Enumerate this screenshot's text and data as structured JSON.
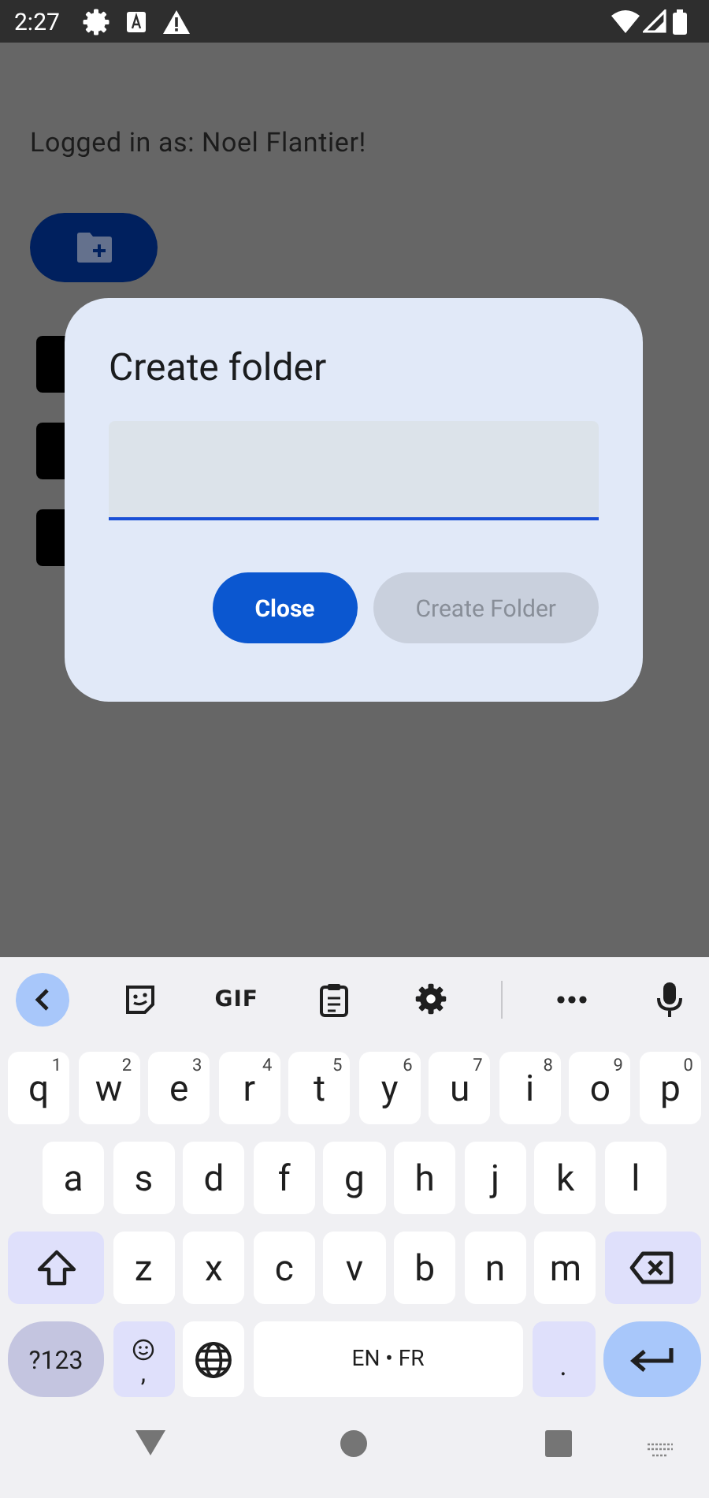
{
  "status_bar": {
    "time": "2:27"
  },
  "app": {
    "greeting": "Logged in as: Noel Flantier!"
  },
  "dialog": {
    "title": "Create folder",
    "field": {
      "focused": true
    },
    "buttons": [
      {
        "label": "Close",
        "disabled": false
      },
      {
        "label": "Create Folder",
        "disabled": true
      }
    ]
  },
  "keyboard": {
    "toolbar": [
      {
        "kind": "back"
      },
      {
        "kind": "sticker"
      },
      {
        "kind": "gif",
        "label": "GIF"
      },
      {
        "kind": "clipboard"
      },
      {
        "kind": "settings"
      },
      {
        "kind": "more"
      },
      {
        "kind": "mic"
      }
    ],
    "rows": [
      {
        "keys": [
          {
            "kind": "letter",
            "label": "q",
            "hint": "1"
          },
          {
            "kind": "letter",
            "label": "w",
            "hint": "2"
          },
          {
            "kind": "letter",
            "label": "e",
            "hint": "3"
          },
          {
            "kind": "letter",
            "label": "r",
            "hint": "4"
          },
          {
            "kind": "letter",
            "label": "t",
            "hint": "5"
          },
          {
            "kind": "letter",
            "label": "y",
            "hint": "6"
          },
          {
            "kind": "letter",
            "label": "u",
            "hint": "7"
          },
          {
            "kind": "letter",
            "label": "i",
            "hint": "8"
          },
          {
            "kind": "letter",
            "label": "o",
            "hint": "9"
          },
          {
            "kind": "letter",
            "label": "p",
            "hint": "0"
          }
        ]
      },
      {
        "keys": [
          {
            "kind": "letter",
            "label": "a"
          },
          {
            "kind": "letter",
            "label": "s"
          },
          {
            "kind": "letter",
            "label": "d"
          },
          {
            "kind": "letter",
            "label": "f"
          },
          {
            "kind": "letter",
            "label": "g"
          },
          {
            "kind": "letter",
            "label": "h"
          },
          {
            "kind": "letter",
            "label": "j"
          },
          {
            "kind": "letter",
            "label": "k"
          },
          {
            "kind": "letter",
            "label": "l"
          }
        ]
      },
      {
        "keys": [
          {
            "kind": "shift"
          },
          {
            "kind": "letter",
            "label": "z"
          },
          {
            "kind": "letter",
            "label": "x"
          },
          {
            "kind": "letter",
            "label": "c"
          },
          {
            "kind": "letter",
            "label": "v"
          },
          {
            "kind": "letter",
            "label": "b"
          },
          {
            "kind": "letter",
            "label": "n"
          },
          {
            "kind": "letter",
            "label": "m"
          },
          {
            "kind": "backspace"
          }
        ]
      },
      {
        "keys": [
          {
            "kind": "symbols",
            "label": "?123"
          },
          {
            "kind": "emoji",
            "label": ","
          },
          {
            "kind": "globe"
          },
          {
            "kind": "space",
            "label": "EN • FR"
          },
          {
            "kind": "period",
            "label": "."
          },
          {
            "kind": "enter"
          }
        ]
      }
    ]
  }
}
